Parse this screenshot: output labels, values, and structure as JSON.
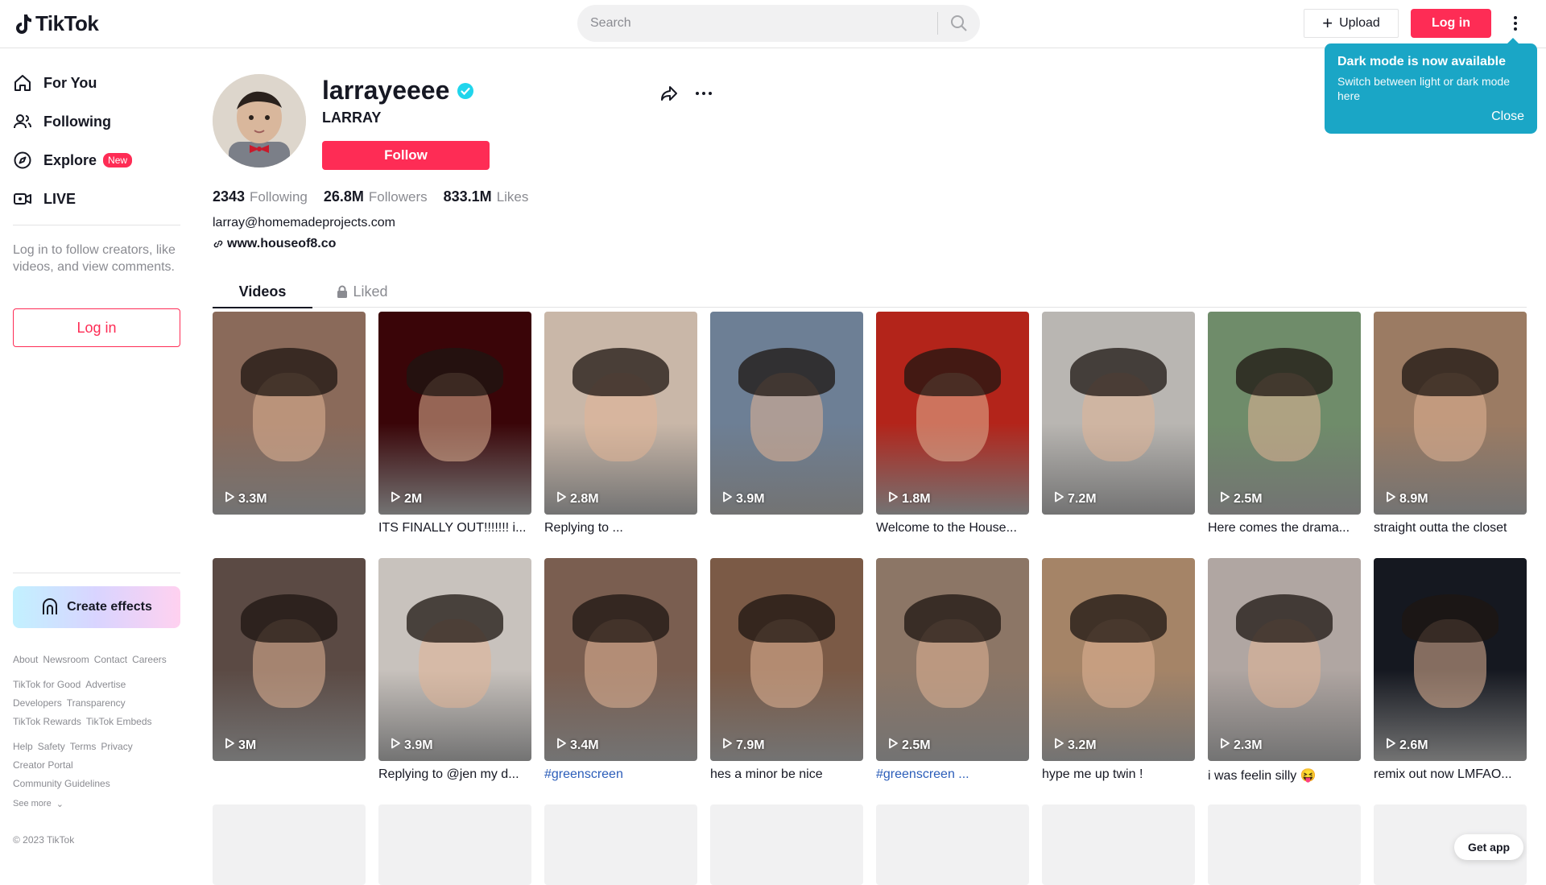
{
  "header": {
    "logo": "TikTok",
    "search_placeholder": "Search",
    "upload_label": "Upload",
    "login_label": "Log in"
  },
  "tooltip": {
    "title": "Dark mode is now available",
    "body": "Switch between light or dark mode here",
    "close": "Close"
  },
  "sidebar": {
    "nav": [
      {
        "label": "For You",
        "icon": "home-icon"
      },
      {
        "label": "Following",
        "icon": "people-icon"
      },
      {
        "label": "Explore",
        "icon": "compass-icon",
        "badge": "New"
      },
      {
        "label": "LIVE",
        "icon": "live-icon"
      }
    ],
    "login_hint": "Log in to follow creators, like videos, and view comments.",
    "login_label": "Log in",
    "effects_label": "Create effects",
    "footer": {
      "row1": [
        "About",
        "Newsroom",
        "Contact",
        "Careers"
      ],
      "row2": [
        "TikTok for Good",
        "Advertise"
      ],
      "row3": [
        "Developers",
        "Transparency"
      ],
      "row4": [
        "TikTok Rewards",
        "TikTok Embeds"
      ],
      "row5": [
        "Help",
        "Safety",
        "Terms",
        "Privacy"
      ],
      "row6": [
        "Creator Portal"
      ],
      "row7": [
        "Community Guidelines"
      ],
      "see_more": "See more",
      "copyright": "© 2023 TikTok"
    }
  },
  "profile": {
    "username": "larrayeeee",
    "nickname": "LARRAY",
    "follow_label": "Follow",
    "following_count": "2343",
    "following_label": "Following",
    "followers_count": "26.8M",
    "followers_label": "Followers",
    "likes_count": "833.1M",
    "likes_label": "Likes",
    "bio": "larray@homemadeprojects.com",
    "link": "www.houseof8.co"
  },
  "tabs": {
    "videos": "Videos",
    "liked": "Liked"
  },
  "videos": [
    {
      "views": "3.3M",
      "caption": "",
      "bg": "#8a6a5a"
    },
    {
      "views": "2M",
      "caption": "ITS FINALLY OUT!!!!!!! i...",
      "bg": "#3a0508"
    },
    {
      "views": "2.8M",
      "caption": "Replying to ...",
      "bg": "#c9b7a8"
    },
    {
      "views": "3.9M",
      "caption": "",
      "bg": "#6d7f95"
    },
    {
      "views": "1.8M",
      "caption": "Welcome to the House...",
      "bg": "#b3241a"
    },
    {
      "views": "7.2M",
      "caption": "",
      "bg": "#b9b6b2"
    },
    {
      "views": "2.5M",
      "caption": "Here comes the drama...",
      "bg": "#6f8c6a"
    },
    {
      "views": "8.9M",
      "caption": "straight outta the closet",
      "bg": "#9b7b63"
    },
    {
      "views": "3M",
      "caption": "",
      "bg": "#5b4a44"
    },
    {
      "views": "3.9M",
      "caption": "Replying to @jen my d...",
      "bg": "#c8c2bd"
    },
    {
      "views": "3.4M",
      "caption": "#greenscreen",
      "bg": "#7a5e50"
    },
    {
      "views": "7.9M",
      "caption": "hes a minor be nice",
      "bg": "#7b5a46"
    },
    {
      "views": "2.5M",
      "caption": "#greenscreen ...",
      "bg": "#8c7666"
    },
    {
      "views": "3.2M",
      "caption": "hype me up twin !",
      "bg": "#a58467"
    },
    {
      "views": "2.3M",
      "caption": "i was feelin silly 😝",
      "bg": "#b0a6a2"
    },
    {
      "views": "2.6M",
      "caption": "remix out now LMFAO...",
      "bg": "#151820"
    }
  ],
  "get_app": "Get app",
  "colors": {
    "brand": "#fe2c55",
    "tooltip": "#1aa6c6",
    "verified": "#20d5ec"
  }
}
